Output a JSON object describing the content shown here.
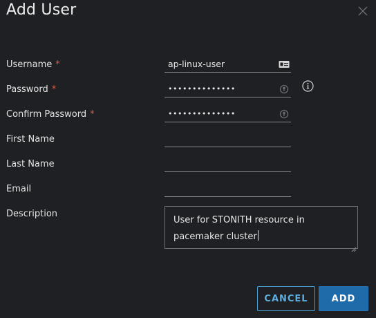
{
  "dialog": {
    "title": "Add User",
    "close_icon": "close-icon"
  },
  "form": {
    "required_marker": "*",
    "username": {
      "label": "Username",
      "value": "ap-linux-user",
      "icon": "id-card-icon"
    },
    "password": {
      "label": "Password",
      "value": "ap-linux-user1",
      "icon": "key-icon"
    },
    "confirm_password": {
      "label": "Confirm Password",
      "value": "ap-linux-user1",
      "icon": "key-icon"
    },
    "first_name": {
      "label": "First Name",
      "value": ""
    },
    "last_name": {
      "label": "Last Name",
      "value": ""
    },
    "email": {
      "label": "Email",
      "value": ""
    },
    "description": {
      "label": "Description",
      "value": "User for STONITH resource in pacemaker cluster"
    },
    "info_icon": "info-icon"
  },
  "buttons": {
    "cancel": "CANCEL",
    "add": "ADD"
  },
  "colors": {
    "background": "#1f2023",
    "required": "#e0573d",
    "accent": "#1f6aa8",
    "accent_text": "#5aaee0"
  }
}
